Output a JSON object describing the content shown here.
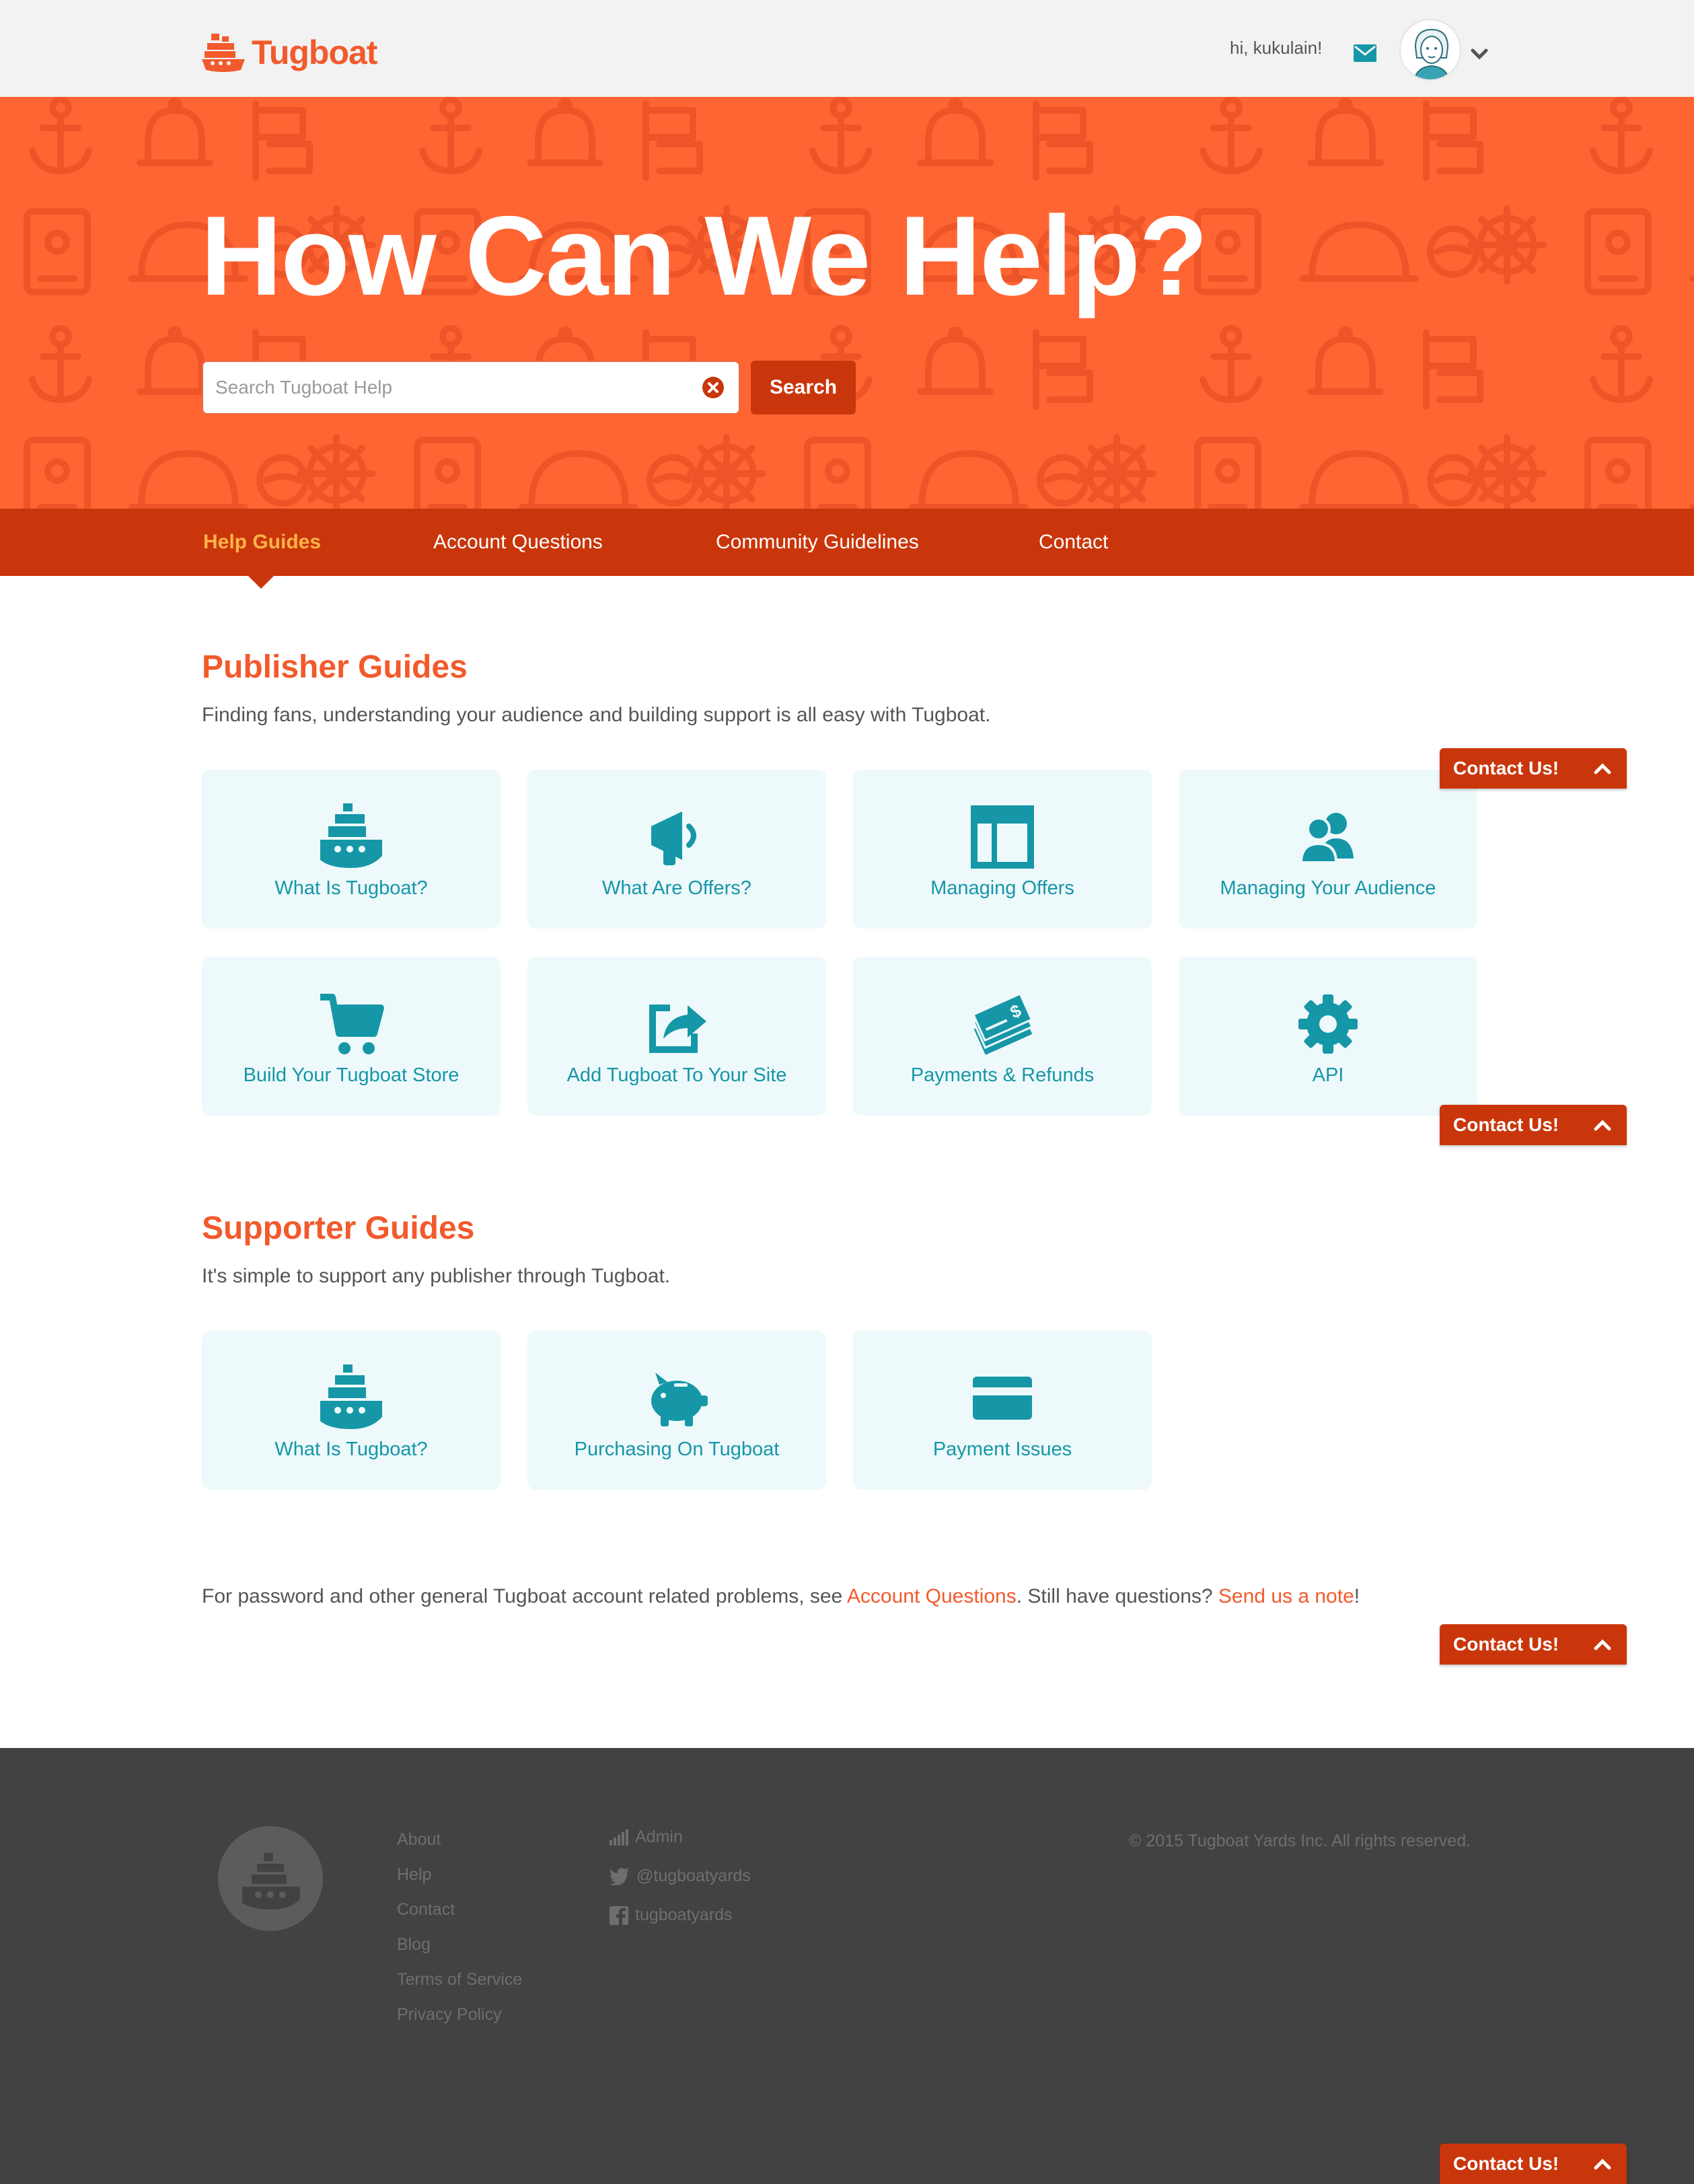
{
  "header": {
    "brand": "Tugboat",
    "greeting": "hi, kukulain!",
    "icons": [
      "tugboat-logo-icon",
      "mail-icon",
      "avatar",
      "chevron-down-icon"
    ]
  },
  "hero": {
    "title": "How Can We Help?",
    "search_placeholder": "Search Tugboat Help",
    "search_value": "",
    "search_button": "Search"
  },
  "tabs": [
    {
      "label": "Help Guides",
      "active": true
    },
    {
      "label": "Account Questions",
      "active": false
    },
    {
      "label": "Community Guidelines",
      "active": false
    },
    {
      "label": "Contact",
      "active": false
    }
  ],
  "publisher": {
    "title": "Publisher Guides",
    "subtitle": "Finding fans, understanding your audience and building support is all easy with Tugboat.",
    "cards": [
      {
        "label": "What Is Tugboat?",
        "icon": "tugboat-icon"
      },
      {
        "label": "What Are Offers?",
        "icon": "megaphone-icon"
      },
      {
        "label": "Managing Offers",
        "icon": "layout-icon"
      },
      {
        "label": "Managing Your Audience",
        "icon": "users-icon"
      },
      {
        "label": "Build Your Tugboat Store",
        "icon": "cart-icon"
      },
      {
        "label": "Add Tugboat To Your Site",
        "icon": "share-icon"
      },
      {
        "label": "Payments & Refunds",
        "icon": "checks-icon"
      },
      {
        "label": "API",
        "icon": "gear-icon"
      }
    ]
  },
  "supporter": {
    "title": "Supporter Guides",
    "subtitle": "It's simple to support any publisher through Tugboat.",
    "cards": [
      {
        "label": "What Is Tugboat?",
        "icon": "tugboat-icon"
      },
      {
        "label": "Purchasing On Tugboat",
        "icon": "piggy-bank-icon"
      },
      {
        "label": "Payment Issues",
        "icon": "credit-card-icon"
      }
    ]
  },
  "note": {
    "prefix": "For password and other general Tugboat account related problems, see ",
    "link1": "Account Questions",
    "middle": ". Still have questions? ",
    "link2": "Send us a note",
    "suffix": "!"
  },
  "contact_tab": {
    "label": "Contact Us!"
  },
  "footer": {
    "links": [
      "About",
      "Help",
      "Contact",
      "Blog",
      "Terms of Service",
      "Privacy Policy"
    ],
    "social": [
      {
        "label": "Admin",
        "icon": "signal-bars-icon"
      },
      {
        "label": "@tugboatyards",
        "icon": "twitter-icon"
      },
      {
        "label": "tugboatyards",
        "icon": "facebook-icon"
      }
    ],
    "copyright": "© 2015 Tugboat Yards Inc. All rights reserved."
  },
  "colors": {
    "brand_orange": "#f25a2c",
    "hero_bg": "#ff6533",
    "dark_orange": "#c9360b",
    "active_tab": "#ffb347",
    "card_bg": "#eef9fb",
    "teal": "#1597a7",
    "footer_bg": "#424242"
  }
}
